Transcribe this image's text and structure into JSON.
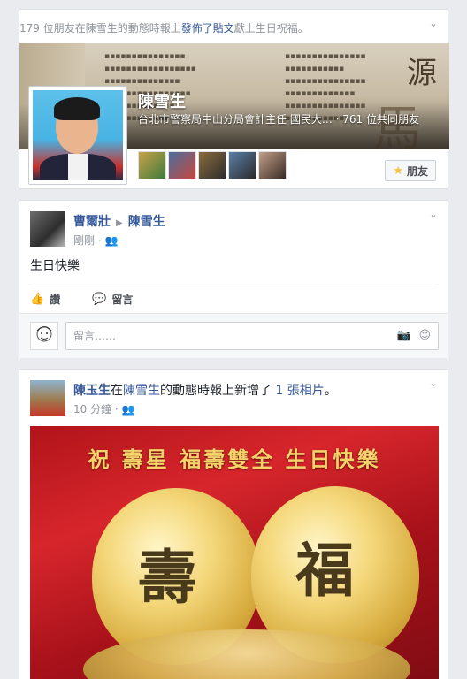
{
  "birthday_card": {
    "header_count": "179",
    "header_pre": " 位朋友在陳雪生的動態時報上",
    "header_link": "發佈了貼文",
    "header_post": "獻上生日祝福。",
    "profile_name": "陳雪生",
    "profile_subline": "台北市警察局中山分局會計主任 國民大… · 761 位共同朋友",
    "friend_button": "朋友",
    "cover_glyphs": [
      "源",
      "馬"
    ]
  },
  "post1": {
    "author": "曹爾壯",
    "target": "陳雪生",
    "time": "剛剛",
    "text": "生日快樂",
    "like_label": "讚",
    "comment_label": "留言",
    "comment_placeholder": "留言……"
  },
  "post2": {
    "author": "陳玉生",
    "action_pre": "在",
    "target": "陳雪生",
    "action_mid": "的動態時報上新增了 ",
    "photo_count": "1 張相片",
    "action_end": "。",
    "time": "10 分鐘",
    "photo_banner": "祝 壽星 福壽雙全 生日快樂",
    "photo_glyph_left": "壽",
    "photo_glyph_right": "福"
  },
  "colors": {
    "link": "#365899",
    "background": "#e9ebee",
    "photo_red": "#d7262c",
    "gold": "#f3d36a"
  },
  "icons": {
    "chevron": "chevron-down-icon",
    "audience": "friends-audience-icon",
    "like": "thumbs-up-icon",
    "comment": "speech-bubble-icon",
    "camera": "camera-icon",
    "emoji": "smiley-icon",
    "star": "star-icon"
  }
}
